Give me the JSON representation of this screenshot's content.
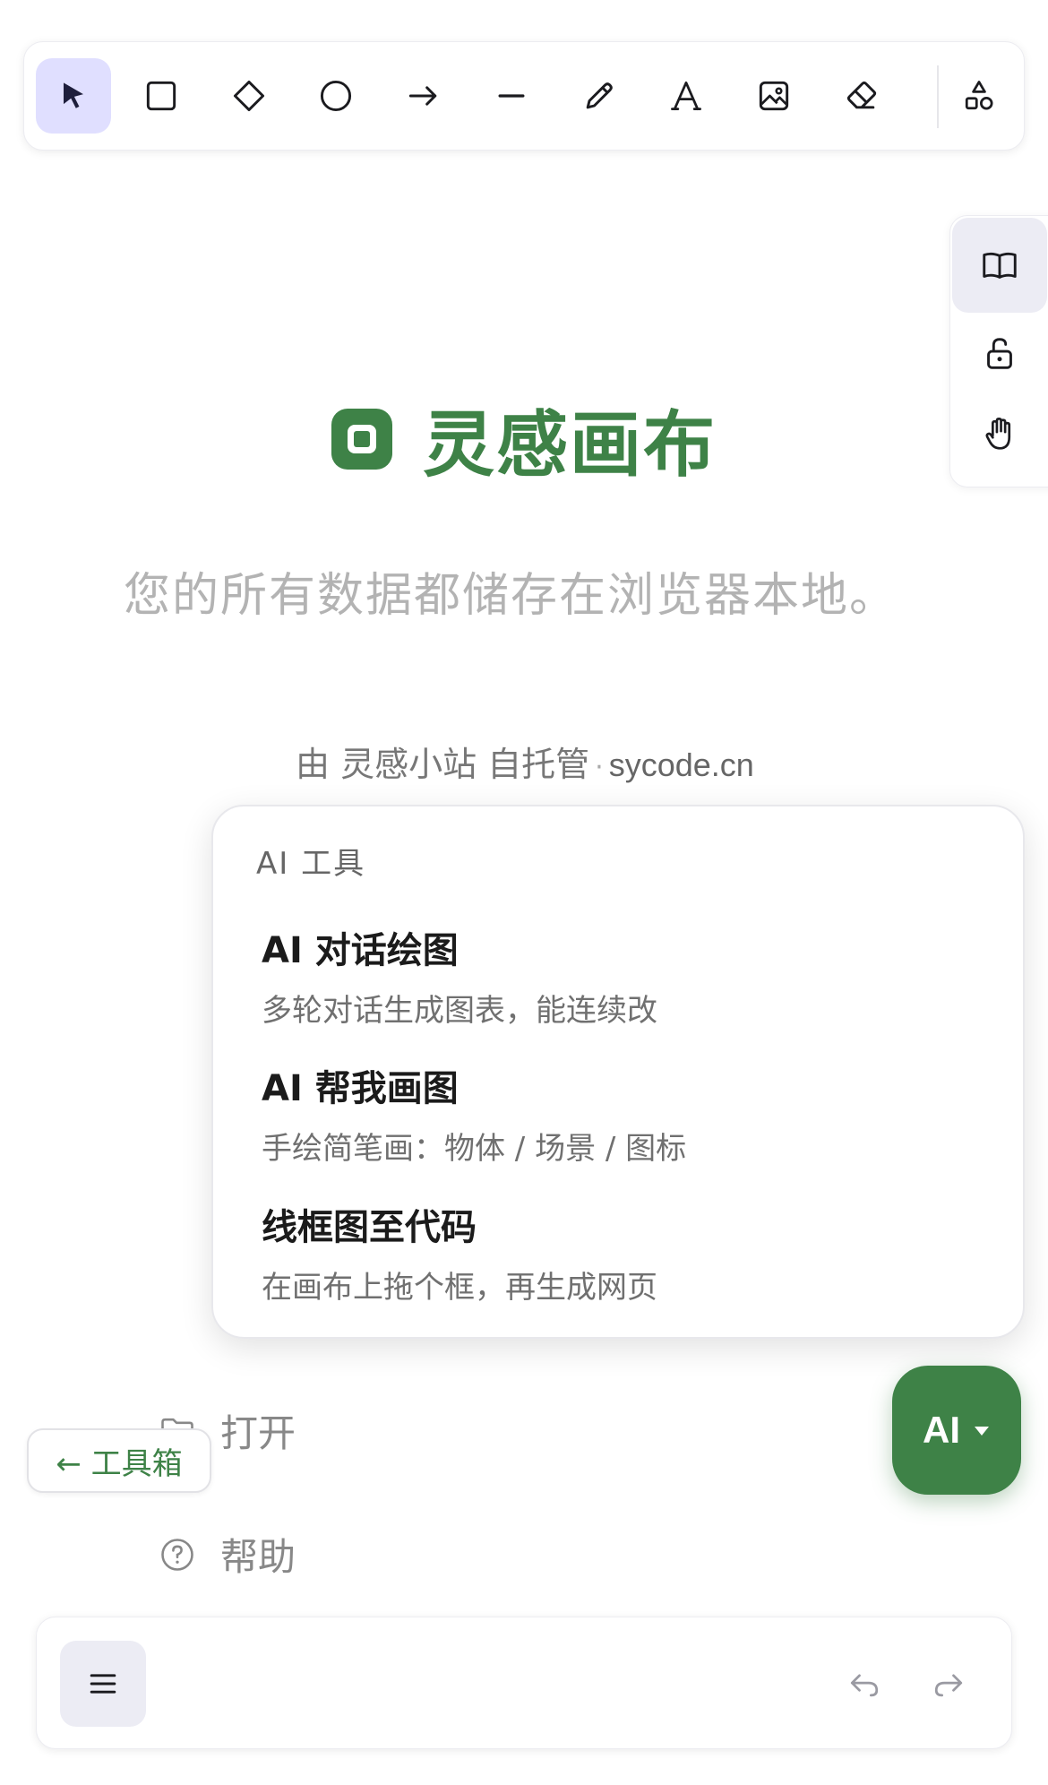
{
  "toolbar": {
    "tools": [
      {
        "id": "selection",
        "icon": "pointer-icon",
        "active": true
      },
      {
        "id": "rectangle",
        "icon": "rectangle-icon"
      },
      {
        "id": "diamond",
        "icon": "diamond-icon"
      },
      {
        "id": "ellipse",
        "icon": "circle-icon"
      },
      {
        "id": "arrow",
        "icon": "arrow-icon"
      },
      {
        "id": "line",
        "icon": "line-icon"
      },
      {
        "id": "draw",
        "icon": "pencil-icon"
      },
      {
        "id": "text",
        "icon": "text-icon"
      },
      {
        "id": "image",
        "icon": "image-icon"
      },
      {
        "id": "eraser",
        "icon": "eraser-icon"
      },
      {
        "id": "more-shapes",
        "icon": "shapes-icon"
      }
    ]
  },
  "side_panel": {
    "items": [
      {
        "icon": "book-icon",
        "active": true
      },
      {
        "icon": "unlock-icon"
      },
      {
        "icon": "hand-icon"
      }
    ]
  },
  "welcome": {
    "title": "灵感画布",
    "tagline": "您的所有数据都储存在浏览器本地。",
    "hosted_prefix": "由 灵感小站 自托管",
    "hosted_sep": "·",
    "hosted_site": "sycode.cn"
  },
  "menu": {
    "open_label": "打开",
    "help_label": "帮助"
  },
  "toolbox_button": {
    "label": "← 工具箱"
  },
  "ai_popup": {
    "header": "AI 工具",
    "options": [
      {
        "title": "AI 对话绘图",
        "desc": "多轮对话生成图表，能连续改"
      },
      {
        "title": "AI 帮我画图",
        "desc": "手绘简笔画：物体 / 场景 / 图标"
      },
      {
        "title": "线框图至代码",
        "desc": "在画布上拖个框，再生成网页"
      }
    ]
  },
  "ai_fab": {
    "label": "AI"
  },
  "colors": {
    "accent": "#3e8247",
    "active_tool_bg": "#e0dfff",
    "icon_dark": "#1b1b1f"
  }
}
